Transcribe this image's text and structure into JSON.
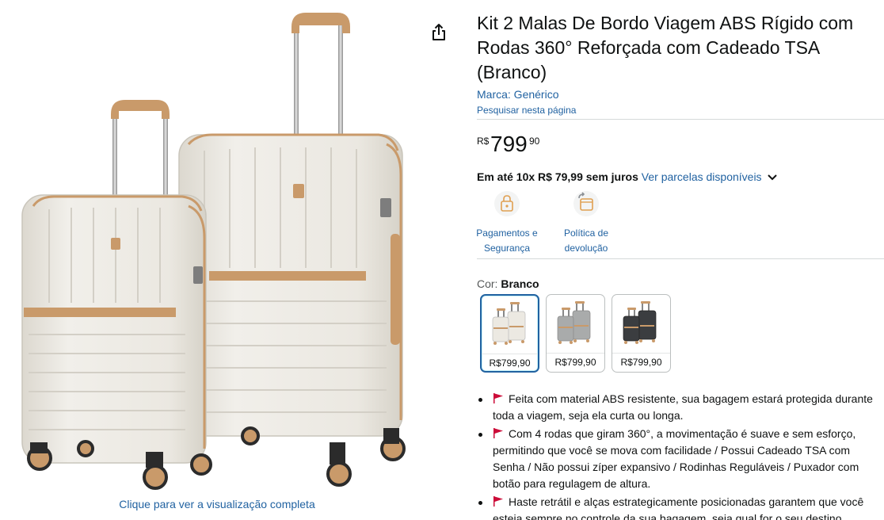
{
  "product": {
    "title": "Kit 2 Malas De Bordo Viagem ABS Rígido com Rodas 360° Reforçada com Cadeado TSA (Branco)",
    "brand_link": "Marca: Genérico",
    "search_page_link": "Pesquisar nesta página"
  },
  "price": {
    "symbol": "R$",
    "whole": "799",
    "fraction": "90"
  },
  "installments": {
    "bold_text": "Em até 10x R$ 79,99 sem juros",
    "link_text": "Ver parcelas disponíveis"
  },
  "badges": [
    {
      "label_line1": "Pagamentos e",
      "label_line2": "Segurança",
      "icon": "secure-payment-icon"
    },
    {
      "label_line1": "Política de",
      "label_line2": "devolução",
      "icon": "return-policy-icon"
    }
  ],
  "color": {
    "label": "Cor:",
    "selected": "Branco"
  },
  "swatches": [
    {
      "color_name": "white",
      "price": "R$799,90",
      "selected": true
    },
    {
      "color_name": "gray",
      "price": "R$799,90",
      "selected": false
    },
    {
      "color_name": "black",
      "price": "R$799,90",
      "selected": false
    }
  ],
  "bullets": [
    "Feita com material ABS resistente, sua bagagem estará protegida durante toda a viagem, seja ela curta ou longa.",
    "Com 4 rodas que giram 360°, a movimentação é suave e sem esforço, permitindo que você se mova com facilidade / Possui Cadeado TSA com Senha / Não possui zíper expansivo / Rodinhas Reguláveis / Puxador com botão para regulagem de altura.",
    "Haste retrátil e alças estrategicamente posicionadas garantem que você esteja sempre no controle da sua bagagem, seja qual for o seu destino."
  ],
  "image_panel": {
    "full_view_link": "Clique para ver a visualização completa"
  },
  "colors": {
    "link": "#2162a1",
    "text": "#0f1111",
    "flag_red": "#cc0c39",
    "swatch_selected_border": "#2162a1",
    "suitcase_shell": "#ece9e2",
    "suitcase_trim": "#c99a6a"
  },
  "icons": [
    "share-icon",
    "chevron-down-icon",
    "flag-icon",
    "secure-payment-icon",
    "return-policy-icon"
  ]
}
